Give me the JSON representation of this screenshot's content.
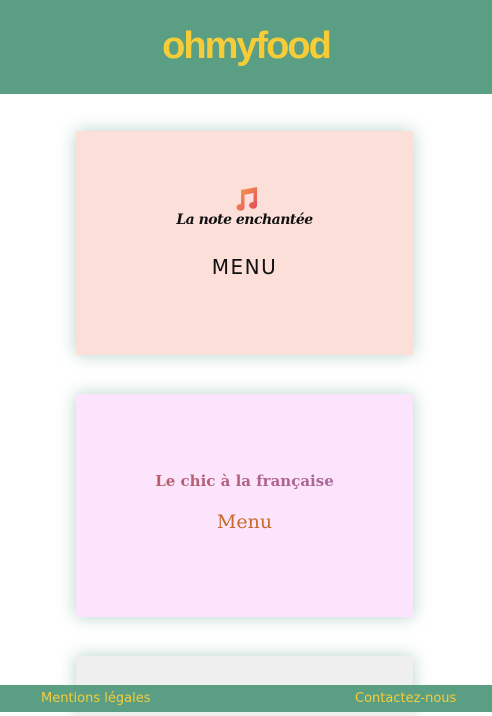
{
  "header": {
    "logo": "ohmyfood"
  },
  "restaurants": [
    {
      "name": "La note enchantée",
      "menu_label": "MENU",
      "icon": "music-note-icon",
      "background": "#fcdfd9"
    },
    {
      "name": "Le chic à la française",
      "menu_label": "Menu",
      "background": "#fce4fd"
    },
    {
      "background": "#efefef"
    }
  ],
  "footer": {
    "legal": "Mentions légales",
    "contact": "Contactez-nous"
  },
  "colors": {
    "brand": "#5a9e84",
    "accent": "#f6cd39"
  }
}
